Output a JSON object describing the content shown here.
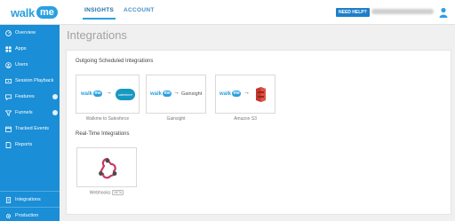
{
  "app": {
    "logo_word": "walk",
    "logo_badge": "me"
  },
  "header": {
    "tabs": [
      {
        "label": "INSIGHTS",
        "active": true
      },
      {
        "label": "ACCOUNT",
        "active": false
      }
    ],
    "need_help": "NEED HELP?"
  },
  "sidebar": {
    "items": [
      {
        "label": "Overview",
        "icon": "gauge-icon"
      },
      {
        "label": "Apps",
        "icon": "grid-icon"
      },
      {
        "label": "Users",
        "icon": "user-icon"
      },
      {
        "label": "Session Playback",
        "icon": "play-icon"
      },
      {
        "label": "Features",
        "icon": "features-icon"
      },
      {
        "label": "Funnels",
        "icon": "funnel-icon"
      },
      {
        "label": "Tracked Events",
        "icon": "events-icon"
      },
      {
        "label": "Reports",
        "icon": "reports-icon"
      }
    ],
    "bottom_items": [
      {
        "label": "Integrations",
        "icon": "integrations-icon"
      },
      {
        "label": "Production",
        "icon": "gear-icon"
      }
    ]
  },
  "main": {
    "title": "Integrations",
    "outgoing_title": "Outgoing Scheduled Integrations",
    "outgoing": [
      {
        "caption": "Walkme to Salesforce",
        "target_label": "salesforce"
      },
      {
        "caption": "Gainsight",
        "target_label": "Gainsight"
      },
      {
        "caption": "Amazon S3",
        "target_label": ""
      }
    ],
    "realtime_title": "Real-Time Integrations",
    "realtime": [
      {
        "caption": "Webhooks",
        "badge": "BETA"
      }
    ]
  },
  "colors": {
    "brand": "#2ba0e0",
    "sidebar": "#1a8ed6",
    "amazon": "#c7372f",
    "webhook": "#c73a63"
  }
}
